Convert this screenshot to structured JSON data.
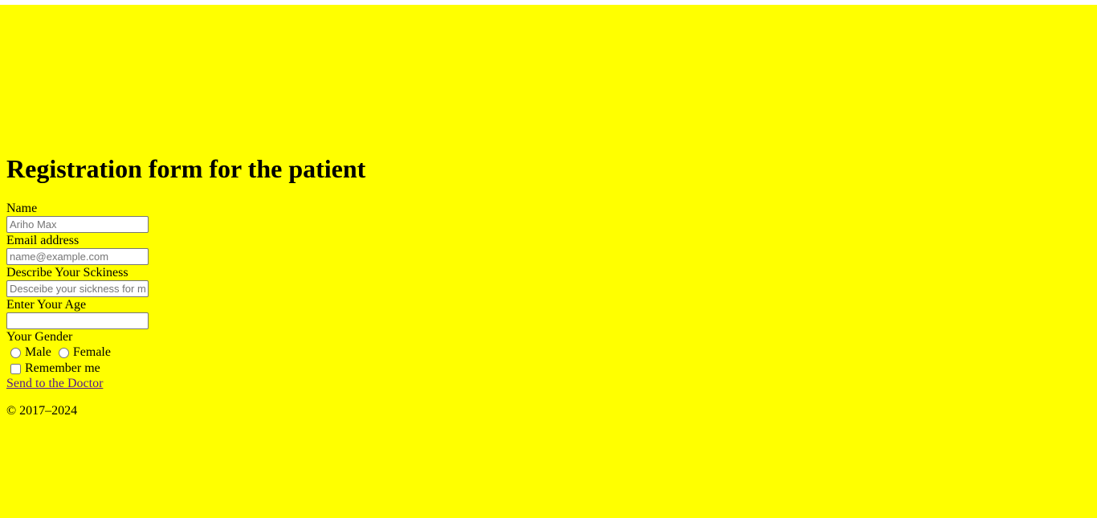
{
  "page": {
    "background_color": "#ffff00",
    "title": "Registration form for the patient"
  },
  "form": {
    "name_label": "Name",
    "name_placeholder": "Ariho Max",
    "email_label": "Email address",
    "email_placeholder": "name@example.com",
    "sickness_label": "Describe Your Sckiness",
    "sickness_placeholder": "Desceibe your sickness for me",
    "age_label": "Enter Your Age",
    "age_value": "",
    "gender_label": "Your Gender",
    "gender_options": [
      "Male",
      "Female"
    ],
    "remember_label": "Remember me",
    "submit_link": "Send to the Doctor"
  },
  "footer": {
    "copyright": "© 2017–2024"
  }
}
